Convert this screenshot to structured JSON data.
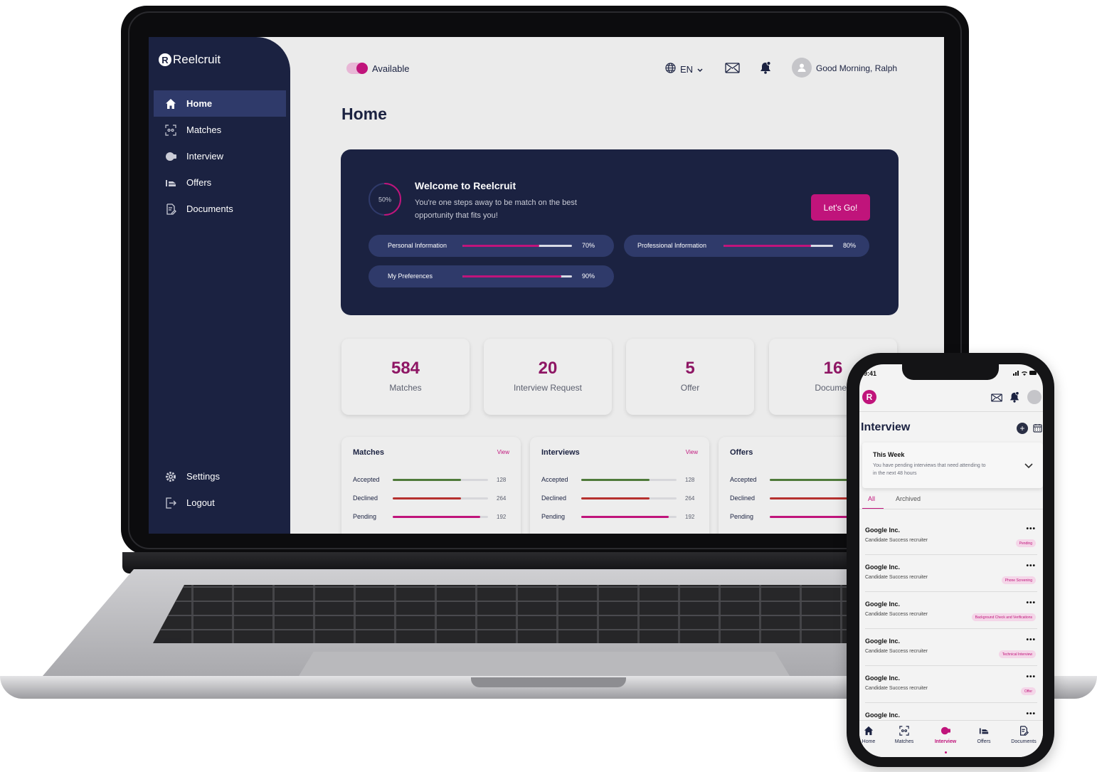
{
  "desktop": {
    "brand": "Reelcruit",
    "nav": [
      {
        "label": "Home",
        "icon": "home-icon",
        "active": true
      },
      {
        "label": "Matches",
        "icon": "matches-icon"
      },
      {
        "label": "Interview",
        "icon": "interview-icon"
      },
      {
        "label": "Offers",
        "icon": "offers-icon"
      },
      {
        "label": "Documents",
        "icon": "documents-icon"
      }
    ],
    "nav_bottom": [
      {
        "label": "Settings",
        "icon": "gear-icon"
      },
      {
        "label": "Logout",
        "icon": "logout-icon"
      }
    ],
    "topbar": {
      "availability": "Available",
      "language": "EN",
      "greeting": "Good Morning, Ralph"
    },
    "page_title": "Home",
    "welcome": {
      "progress_label": "50%",
      "progress": 0.5,
      "title": "Welcome to Reelcruit",
      "subtitle": "You're one steps away to be match on the best opportunity that fits you!",
      "cta": "Let's Go!",
      "sections": [
        {
          "label": "Personal Information",
          "value": "70%",
          "progress": 0.7
        },
        {
          "label": "Professional Information",
          "value": "80%",
          "progress": 0.8
        },
        {
          "label": "My Preferences",
          "value": "90%",
          "progress": 0.9
        }
      ]
    },
    "stats": [
      {
        "value": "584",
        "label": "Matches"
      },
      {
        "value": "20",
        "label": "Interview Request"
      },
      {
        "value": "5",
        "label": "Offer"
      },
      {
        "value": "16",
        "label": "Documen"
      }
    ],
    "panels": [
      {
        "title": "Matches",
        "view": "View",
        "rows": [
          {
            "label": "Accepted",
            "value": "128",
            "progress": 0.72,
            "color": "#4f7a3a"
          },
          {
            "label": "Declined",
            "value": "264",
            "progress": 0.72,
            "color": "#b6312e"
          },
          {
            "label": "Pending",
            "value": "192",
            "progress": 0.92,
            "color": "#c0147b"
          }
        ]
      },
      {
        "title": "Interviews",
        "view": "View",
        "rows": [
          {
            "label": "Accepted",
            "value": "128",
            "progress": 0.72,
            "color": "#4f7a3a"
          },
          {
            "label": "Declined",
            "value": "264",
            "progress": 0.72,
            "color": "#b6312e"
          },
          {
            "label": "Pending",
            "value": "192",
            "progress": 0.92,
            "color": "#c0147b"
          }
        ]
      },
      {
        "title": "Offers",
        "view": "",
        "rows": [
          {
            "label": "Accepted",
            "value": "",
            "progress": 0.9,
            "color": "#4f7a3a"
          },
          {
            "label": "Declined",
            "value": "",
            "progress": 0.9,
            "color": "#b6312e"
          },
          {
            "label": "Pending",
            "value": "",
            "progress": 0.9,
            "color": "#c0147b"
          }
        ]
      }
    ]
  },
  "phone": {
    "time": "9:41",
    "title": "Interview",
    "week": {
      "title": "This Week",
      "subtitle": "You have pending interviews that need attending to in the next 48 hours"
    },
    "tabs": [
      {
        "label": "All",
        "active": true
      },
      {
        "label": "Archived"
      }
    ],
    "items": [
      {
        "company": "Google Inc.",
        "role": "Candidate Success recruiter",
        "status": "Pending"
      },
      {
        "company": "Google Inc.",
        "role": "Candidate Success recruiter",
        "status": "Phone Screening"
      },
      {
        "company": "Google Inc.",
        "role": "Candidate Success recruiter",
        "status": "Background Check and Verifications"
      },
      {
        "company": "Google Inc.",
        "role": "Candidate Success recruiter",
        "status": "Technical Interview"
      },
      {
        "company": "Google Inc.",
        "role": "Candidate Success recruiter",
        "status": "Offer"
      },
      {
        "company": "Google Inc.",
        "role": "",
        "status": ""
      }
    ],
    "bottom_nav": [
      {
        "label": "Home",
        "icon": "home-icon"
      },
      {
        "label": "Matches",
        "icon": "matches-icon"
      },
      {
        "label": "Interview",
        "icon": "interview-icon",
        "active": true
      },
      {
        "label": "Offers",
        "icon": "offers-icon"
      },
      {
        "label": "Documents",
        "icon": "documents-icon"
      }
    ]
  },
  "colors": {
    "navy": "#1b2241",
    "accent": "#c0147b",
    "accent_dark": "#8e1664",
    "green": "#4f7a3a",
    "red": "#b6312e"
  }
}
